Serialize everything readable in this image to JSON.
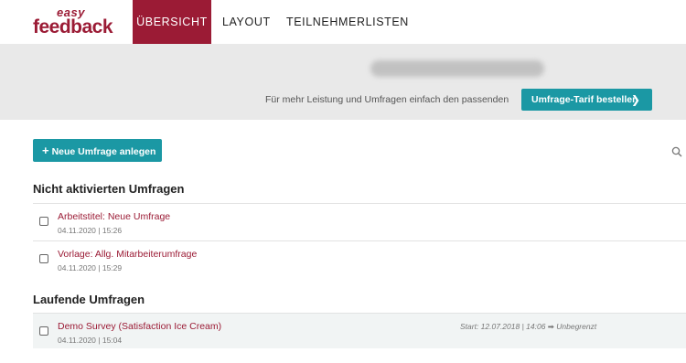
{
  "logo": {
    "easy": "easy",
    "name": "feedback"
  },
  "nav": {
    "tabs": [
      {
        "label": "ÜBERSICHT",
        "active": true
      },
      {
        "label": "LAYOUT",
        "active": false
      },
      {
        "label": "TEILNEHMERLISTEN",
        "active": false
      }
    ]
  },
  "banner": {
    "promo_text": "Für mehr Leistung und Umfragen einfach den passenden",
    "promo_button": "Umfrage-Tarif bestellen",
    "promo_button_icon": "chevron-right-icon"
  },
  "main": {
    "new_survey_button": "Neue Umfrage anlegen",
    "new_survey_icon": "plus-icon",
    "search_icon": "search-icon",
    "sections": [
      {
        "title": "Nicht aktivierten Umfragen",
        "items": [
          {
            "title": "Arbeitstitel: Neue Umfrage",
            "meta": "04.11.2020 | 15:26"
          },
          {
            "title": "Vorlage: Allg. Mitarbeiterumfrage",
            "meta": "04.11.2020 | 15:29"
          }
        ]
      },
      {
        "title": "Laufende Umfragen",
        "items": [
          {
            "title": "Demo Survey (Satisfaction Ice Cream)",
            "meta": "04.11.2020 | 15:04",
            "extra": "Start: 12.07.2018 | 14:06 ➡ Unbegrenzt"
          }
        ]
      }
    ]
  },
  "colors": {
    "brand": "#9b1b35",
    "accent": "#1b98a4",
    "banner_bg": "#e9e9e9"
  }
}
